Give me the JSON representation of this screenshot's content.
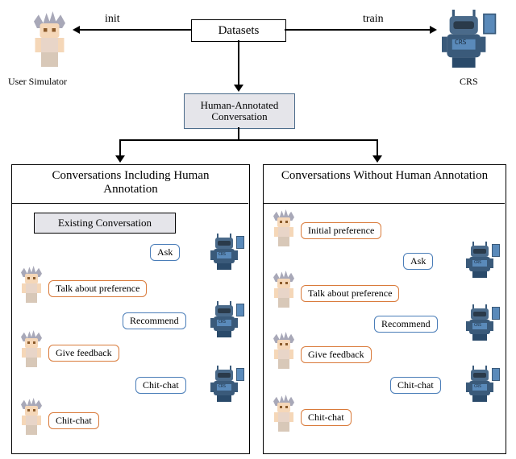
{
  "top": {
    "datasets": "Datasets",
    "init": "init",
    "train": "train",
    "user_simulator": "User Simulator",
    "crs": "CRS",
    "human_annotated": "Human-Annotated Conversation"
  },
  "left": {
    "title": "Conversations Including Human Annotation",
    "existing": "Existing Conversation",
    "bubbles": {
      "ask": "Ask",
      "talk_pref": "Talk about preference",
      "recommend": "Recommend",
      "give_feedback": "Give feedback",
      "chit_r": "Chit-chat",
      "chit_u": "Chit-chat"
    }
  },
  "right": {
    "title": "Conversations Without Human Annotation",
    "bubbles": {
      "initial_pref": "Initial preference",
      "ask": "Ask",
      "talk_pref": "Talk about preference",
      "recommend": "Recommend",
      "give_feedback": "Give feedback",
      "chit_r": "Chit-chat",
      "chit_u": "Chit-chat"
    }
  }
}
